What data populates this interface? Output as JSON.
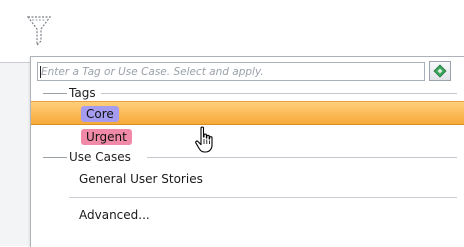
{
  "search": {
    "placeholder": "Enter a Tag or Use Case. Select and apply.",
    "value": ""
  },
  "icons": {
    "filter": "filter-icon",
    "apply": "apply-tag-icon",
    "cursor": "hand-pointer-icon"
  },
  "sections": {
    "tags_label": "Tags",
    "use_cases_label": "Use Cases"
  },
  "tags": [
    {
      "label": "Core",
      "color": "#a59cf0",
      "highlighted": true
    },
    {
      "label": "Urgent",
      "color": "#f08aa8",
      "highlighted": false
    }
  ],
  "use_cases": [
    {
      "label": "General User Stories"
    }
  ],
  "advanced_label": "Advanced...",
  "colors": {
    "highlight": "#f7b24a",
    "core_chip": "#a59cf0",
    "urgent_chip": "#f08aa8"
  }
}
